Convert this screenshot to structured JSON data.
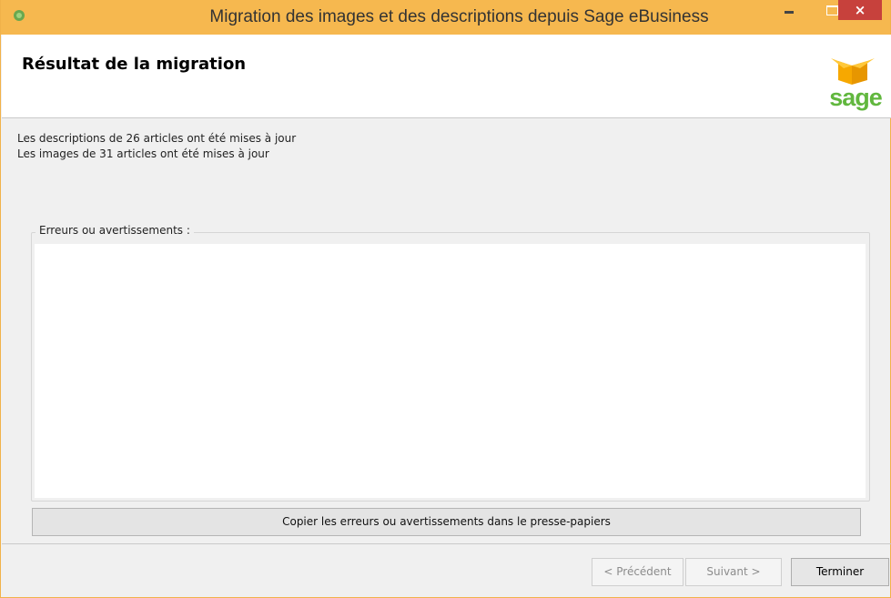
{
  "window": {
    "title": "Migration des images et des descriptions depuis Sage eBusiness",
    "close_glyph": "×"
  },
  "header": {
    "title": "Résultat de la migration",
    "logo_text": "sage",
    "logo_colors": {
      "box": "#f7a800",
      "text": "#61b73e"
    }
  },
  "messages": [
    "Les descriptions de 26 articles ont été mises à jour",
    "Les images de 31 articles ont été mises à jour"
  ],
  "errors_group": {
    "label": "Erreurs ou avertissements :",
    "content": ""
  },
  "copy_button": "Copier les erreurs ou avertissements dans le presse-papiers",
  "footer": {
    "prev": "< Précédent",
    "next": "Suivant >",
    "finish": "Terminer"
  },
  "colors": {
    "titlebar": "#f6b84f",
    "close": "#c7413c"
  }
}
